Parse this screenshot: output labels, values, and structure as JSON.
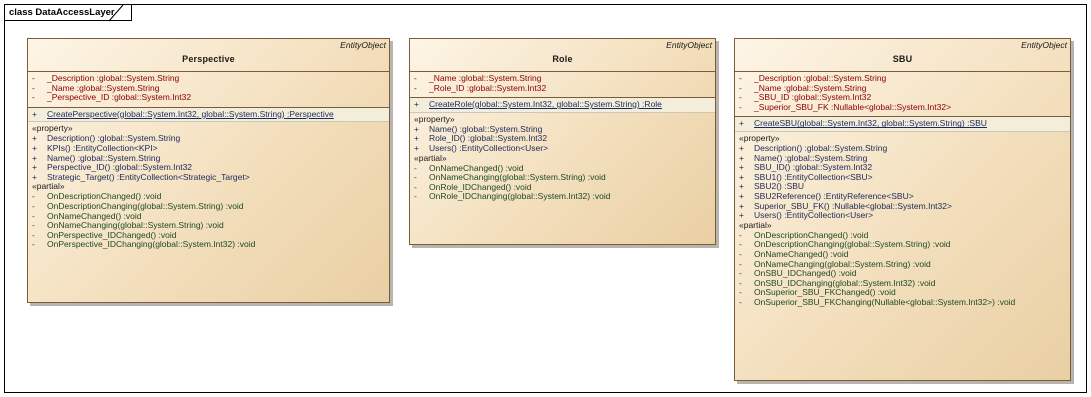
{
  "package": {
    "title": "class DataAccessLayer"
  },
  "classes": {
    "perspective": {
      "stereotype": "EntityObject",
      "name": "Perspective",
      "attributes": [
        {
          "vis": "-",
          "text": "_Description  :global::System.String"
        },
        {
          "vis": "-",
          "text": "_Name  :global::System.String"
        },
        {
          "vis": "-",
          "text": "_Perspective_ID  :global::System.Int32"
        }
      ],
      "constructor": {
        "vis": "+",
        "text": "CreatePerspective(global::System.Int32, global::System.String)  :Perspective"
      },
      "property_group": "«property»",
      "properties": [
        {
          "vis": "+",
          "text": "Description()  :global::System.String"
        },
        {
          "vis": "+",
          "text": "KPIs()  :EntityCollection<KPI>"
        },
        {
          "vis": "+",
          "text": "Name()  :global::System.String"
        },
        {
          "vis": "+",
          "text": "Perspective_ID()  :global::System.Int32"
        },
        {
          "vis": "+",
          "text": "Strategic_Target()  :EntityCollection<Strategic_Target>"
        }
      ],
      "partial_group": "«partial»",
      "partials": [
        {
          "vis": "-",
          "text": "OnDescriptionChanged()  :void"
        },
        {
          "vis": "-",
          "text": "OnDescriptionChanging(global::System.String)  :void"
        },
        {
          "vis": "-",
          "text": "OnNameChanged()  :void"
        },
        {
          "vis": "-",
          "text": "OnNameChanging(global::System.String)  :void"
        },
        {
          "vis": "-",
          "text": "OnPerspective_IDChanged()  :void"
        },
        {
          "vis": "-",
          "text": "OnPerspective_IDChanging(global::System.Int32)  :void"
        }
      ]
    },
    "role": {
      "stereotype": "EntityObject",
      "name": "Role",
      "attributes": [
        {
          "vis": "-",
          "text": "_Name  :global::System.String"
        },
        {
          "vis": "-",
          "text": "_Role_ID  :global::System.Int32"
        }
      ],
      "constructor": {
        "vis": "+",
        "text": "CreateRole(global::System.Int32, global::System.String)  :Role"
      },
      "property_group": "«property»",
      "properties": [
        {
          "vis": "+",
          "text": "Name()  :global::System.String"
        },
        {
          "vis": "+",
          "text": "Role_ID()  :global::System.Int32"
        },
        {
          "vis": "+",
          "text": "Users()  :EntityCollection<User>"
        }
      ],
      "partial_group": "«partial»",
      "partials": [
        {
          "vis": "-",
          "text": "OnNameChanged()  :void"
        },
        {
          "vis": "-",
          "text": "OnNameChanging(global::System.String)  :void"
        },
        {
          "vis": "-",
          "text": "OnRole_IDChanged()  :void"
        },
        {
          "vis": "-",
          "text": "OnRole_IDChanging(global::System.Int32)  :void"
        }
      ]
    },
    "sbu": {
      "stereotype": "EntityObject",
      "name": "SBU",
      "attributes": [
        {
          "vis": "-",
          "text": "_Description  :global::System.String"
        },
        {
          "vis": "-",
          "text": "_Name  :global::System.String"
        },
        {
          "vis": "-",
          "text": "_SBU_ID  :global::System.Int32"
        },
        {
          "vis": "-",
          "text": "_Superior_SBU_FK  :Nullable<global::System.Int32>"
        }
      ],
      "constructor": {
        "vis": "+",
        "text": "CreateSBU(global::System.Int32, global::System.String)  :SBU"
      },
      "property_group": "«property»",
      "properties": [
        {
          "vis": "+",
          "text": "Description()  :global::System.String"
        },
        {
          "vis": "+",
          "text": "Name()  :global::System.String"
        },
        {
          "vis": "+",
          "text": "SBU_ID()  :global::System.Int32"
        },
        {
          "vis": "+",
          "text": "SBU1()  :EntityCollection<SBU>"
        },
        {
          "vis": "+",
          "text": "SBU2()  :SBU"
        },
        {
          "vis": "+",
          "text": "SBU2Reference()  :EntityReference<SBU>"
        },
        {
          "vis": "+",
          "text": "Superior_SBU_FK()  :Nullable<global::System.Int32>"
        },
        {
          "vis": "+",
          "text": "Users()  :EntityCollection<User>"
        }
      ],
      "partial_group": "«partial»",
      "partials": [
        {
          "vis": "-",
          "text": "OnDescriptionChanged()  :void"
        },
        {
          "vis": "-",
          "text": "OnDescriptionChanging(global::System.String)  :void"
        },
        {
          "vis": "-",
          "text": "OnNameChanged()  :void"
        },
        {
          "vis": "-",
          "text": "OnNameChanging(global::System.String)  :void"
        },
        {
          "vis": "-",
          "text": "OnSBU_IDChanged()  :void"
        },
        {
          "vis": "-",
          "text": "OnSBU_IDChanging(global::System.Int32)  :void"
        },
        {
          "vis": "-",
          "text": "OnSuperior_SBU_FKChanged()  :void"
        },
        {
          "vis": "-",
          "text": "OnSuperior_SBU_FKChanging(Nullable<global::System.Int32>)  :void"
        }
      ]
    }
  }
}
